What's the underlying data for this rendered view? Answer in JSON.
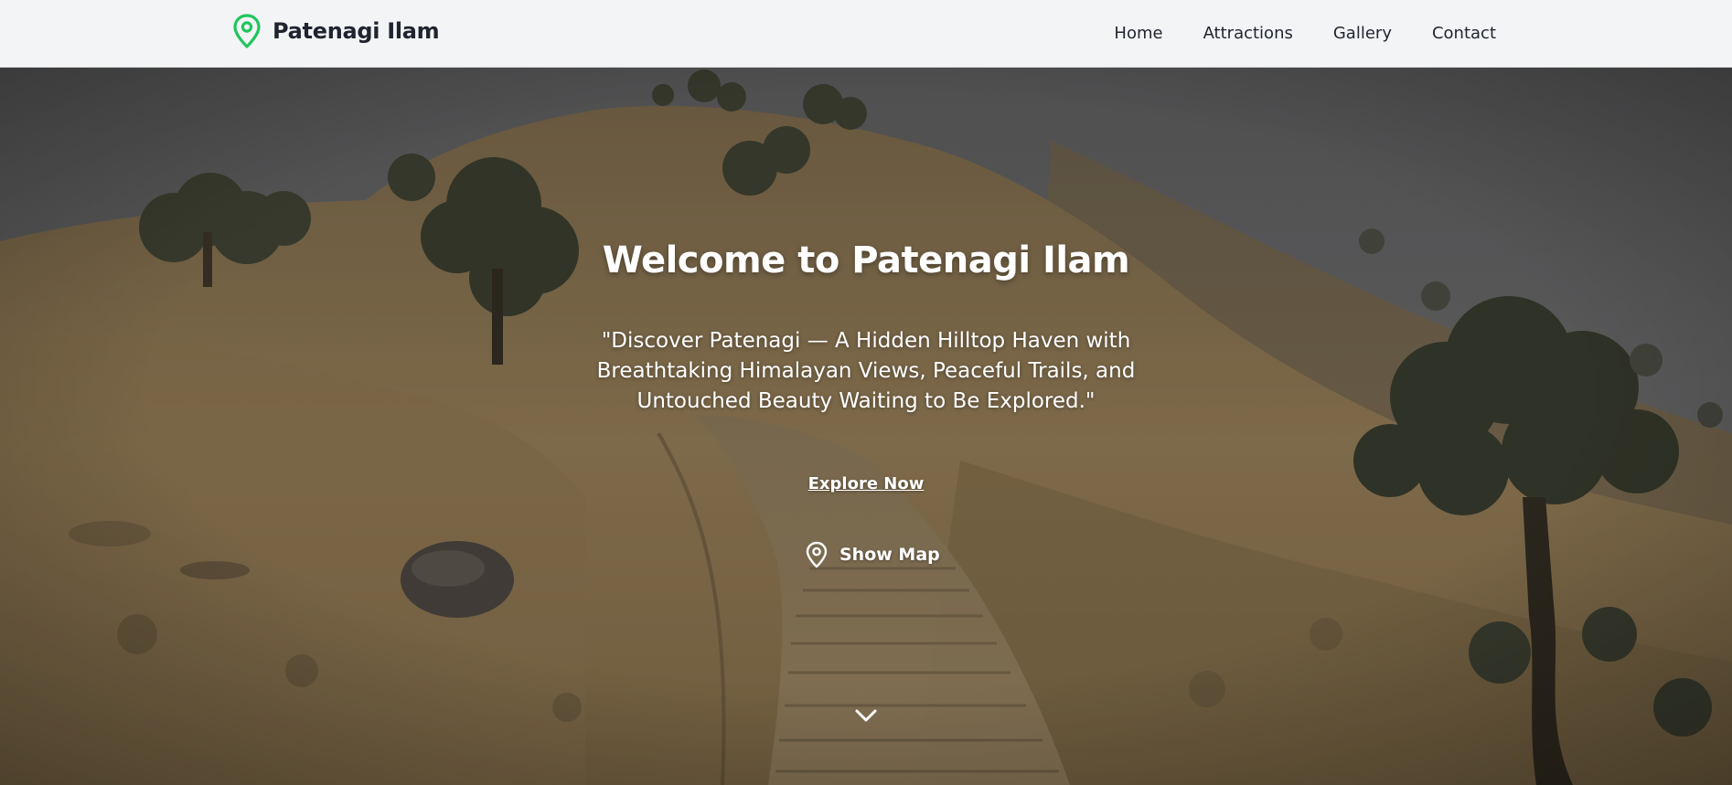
{
  "header": {
    "brand": {
      "title": "Patenagi Ilam",
      "icon": "map-pin-icon",
      "icon_color": "#22c55e"
    },
    "nav": [
      {
        "label": "Home"
      },
      {
        "label": "Attractions"
      },
      {
        "label": "Gallery"
      },
      {
        "label": "Contact"
      }
    ]
  },
  "hero": {
    "background": "hilltop-trail-photo",
    "title": "Welcome to Patenagi Ilam",
    "tagline": "\"Discover Patenagi — A Hidden Hilltop Haven with Breathtaking Himalayan Views, Peaceful Trails, and Untouched Beauty Waiting to Be Explored.\"",
    "cta_label": "Explore Now",
    "map_button_label": "Show Map",
    "map_icon": "map-pin-icon",
    "scroll_icon": "chevron-down-icon"
  },
  "colors": {
    "header_bg": "#f3f4f5",
    "accent": "#22c55e",
    "text_dark": "#1f2430",
    "hero_text": "#ffffff"
  }
}
